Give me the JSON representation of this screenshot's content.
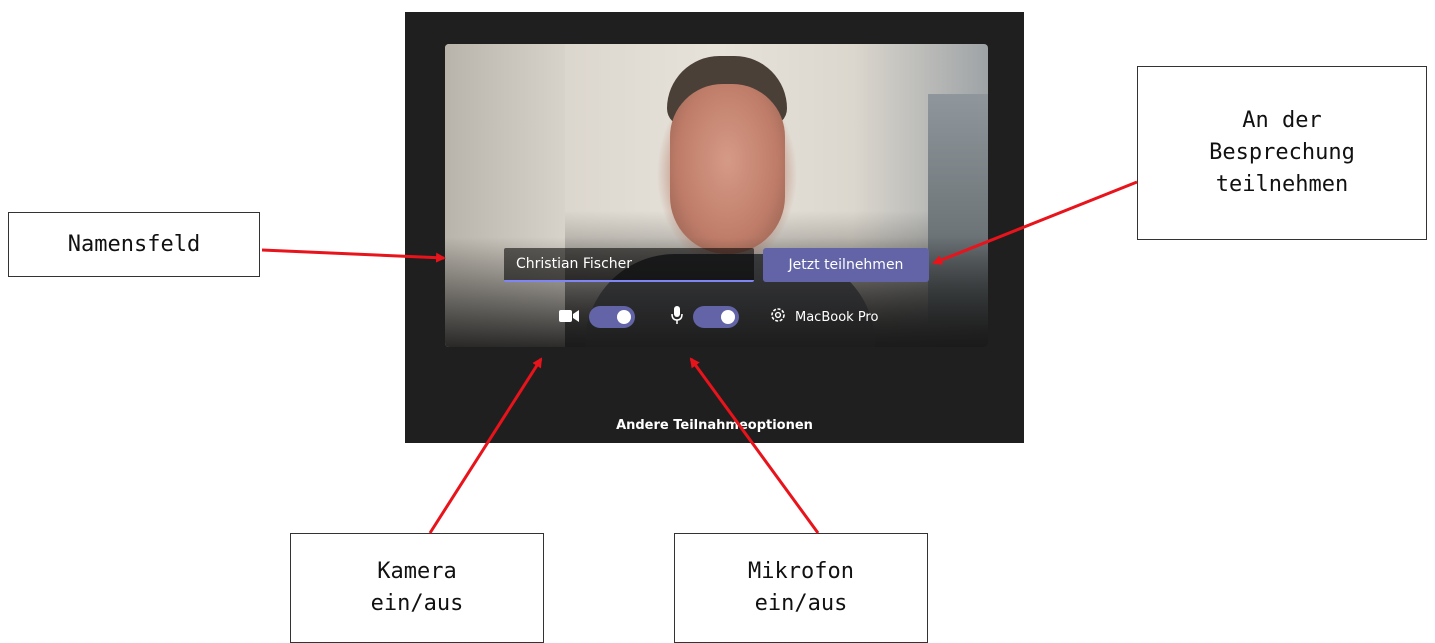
{
  "teams_prejoin": {
    "name_value": "Christian Fischer",
    "join_button_label": "Jetzt teilnehmen",
    "camera_toggle": "on",
    "microphone_toggle": "on",
    "device_label": "MacBook Pro",
    "other_options_label": "Andere Teilnahmeoptionen"
  },
  "annotations": {
    "name_field": "Namensfeld",
    "join_meeting": "An der\nBesprechung\nteilnehmen",
    "camera": "Kamera\nein/aus",
    "microphone": "Mikrofon\nein/aus"
  },
  "colors": {
    "accent": "#6264a7",
    "panel_background": "#201f1f",
    "arrow": "#e8131b"
  },
  "icons": [
    "camera-icon",
    "microphone-icon",
    "gear-icon"
  ]
}
